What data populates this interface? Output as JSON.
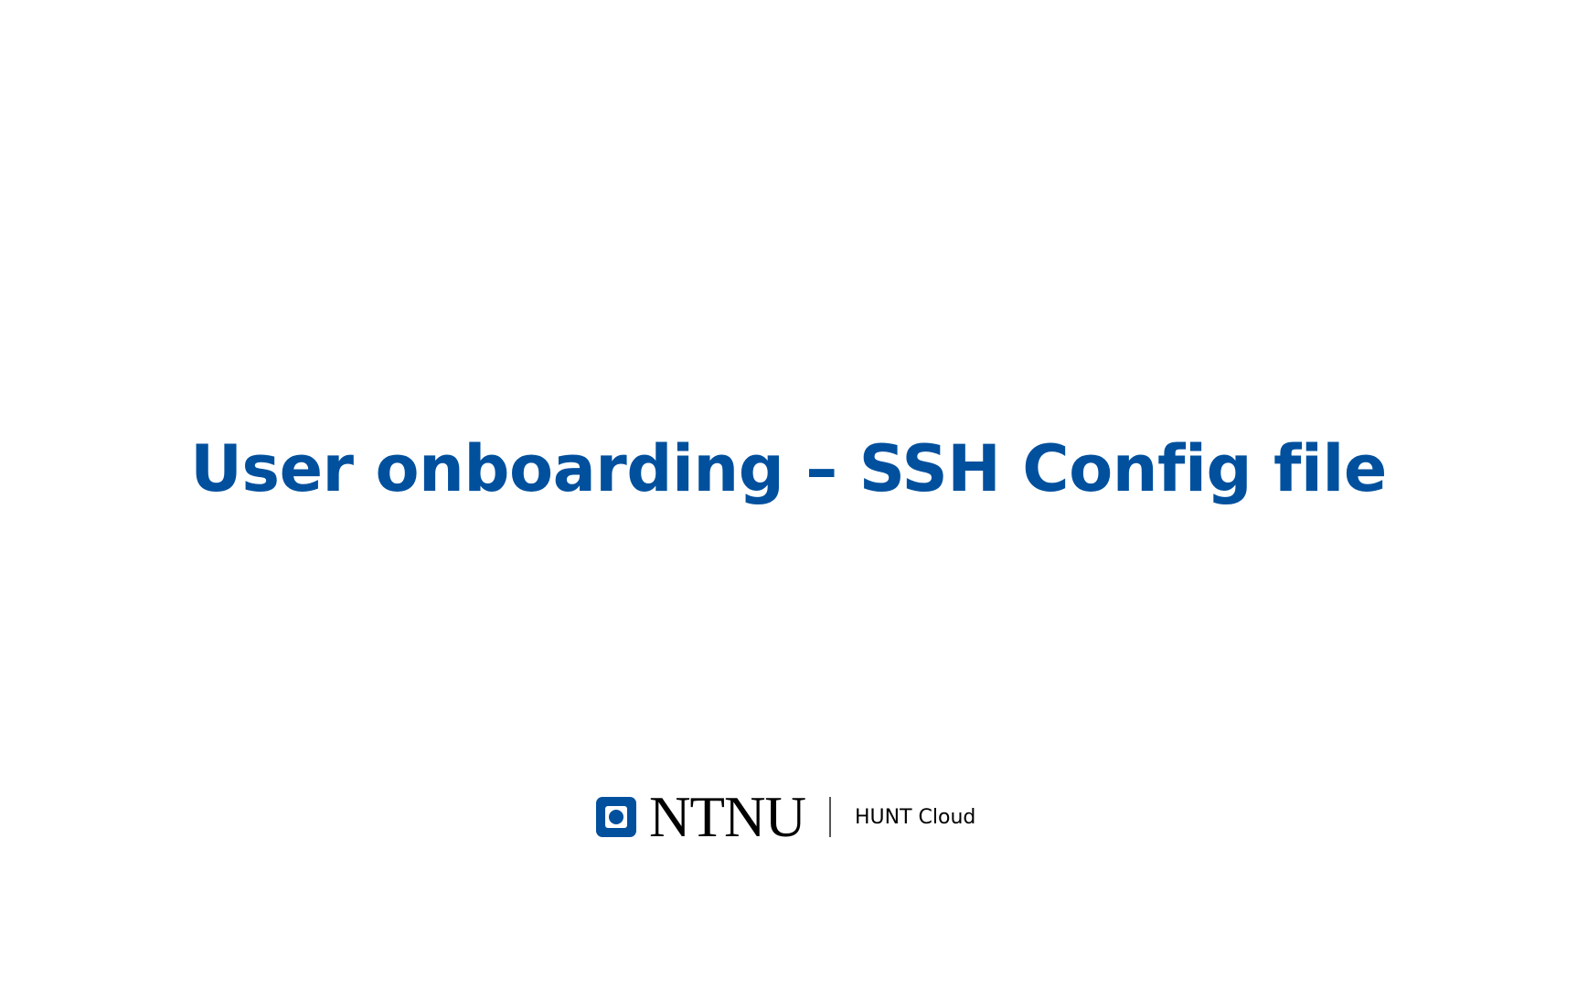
{
  "slide": {
    "title": "User onboarding – SSH Config file"
  },
  "footer": {
    "logo_icon": "ntnu-logo-icon",
    "wordmark": "NTNU",
    "org_name": "HUNT Cloud"
  },
  "colors": {
    "title": "#00509e",
    "logo": "#00509e",
    "background": "#ffffff"
  }
}
